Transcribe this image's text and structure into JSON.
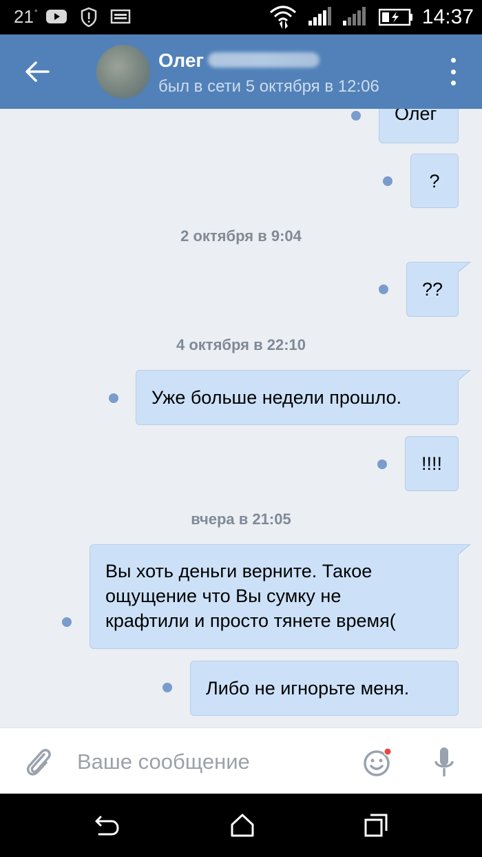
{
  "status_bar": {
    "temperature": "21",
    "degree": "°",
    "time": "14:37"
  },
  "header": {
    "contact_name": "Олег",
    "last_seen": "был в сети 5 октября в 12:06"
  },
  "messages": [
    {
      "text": "Олег"
    },
    {
      "text": "?"
    },
    {
      "date": "2 октября в 9:04"
    },
    {
      "text": "??"
    },
    {
      "date": "4 октября в 22:10"
    },
    {
      "text": "Уже больше недели прошло."
    },
    {
      "text": "!!!!"
    },
    {
      "date": "вчера в 21:05"
    },
    {
      "text": "Вы хоть деньги верните. Такое\nощущение что Вы сумку не\nкрафтили и просто тянете время("
    },
    {
      "text": "Либо не игнорьте меня."
    }
  ],
  "input": {
    "placeholder": "Ваше сообщение"
  },
  "icons": {
    "back": "arrow-left-icon",
    "menu": "more-vertical-icon",
    "attach": "paperclip-icon",
    "emoji": "smile-icon",
    "mic": "microphone-icon",
    "nav_back": "nav-back-icon",
    "nav_home": "nav-home-icon",
    "nav_recents": "nav-recents-icon"
  },
  "colors": {
    "header": "#5181b8",
    "bubble": "#cce1f8",
    "background": "#ebeef3",
    "unread_dot": "#7a9ccc"
  }
}
